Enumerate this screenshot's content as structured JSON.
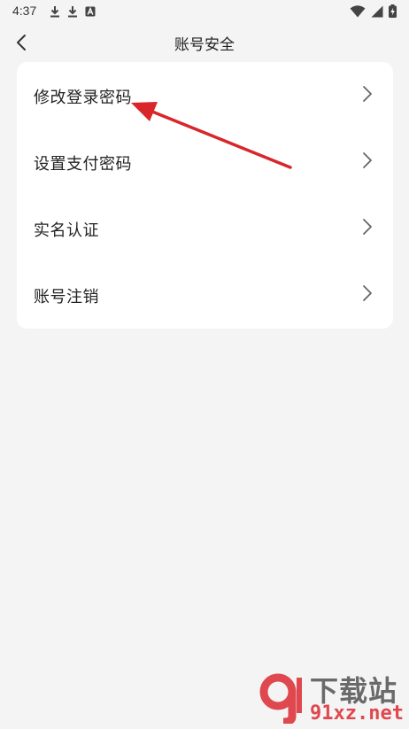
{
  "status_bar": {
    "time": "4:37",
    "left_icons": [
      "download-icon",
      "download-icon",
      "app-notification-icon"
    ],
    "right_icons": [
      "wifi-icon",
      "signal-icon",
      "battery-charging-icon"
    ]
  },
  "header": {
    "title": "账号安全",
    "back_icon": "chevron-left-icon"
  },
  "menu": {
    "items": [
      {
        "label": "修改登录密码"
      },
      {
        "label": "设置支付密码"
      },
      {
        "label": "实名认证"
      },
      {
        "label": "账号注销"
      }
    ]
  },
  "annotation": {
    "color": "#d8262b"
  },
  "watermark": {
    "title": "下载站",
    "url": "91xz.net"
  }
}
